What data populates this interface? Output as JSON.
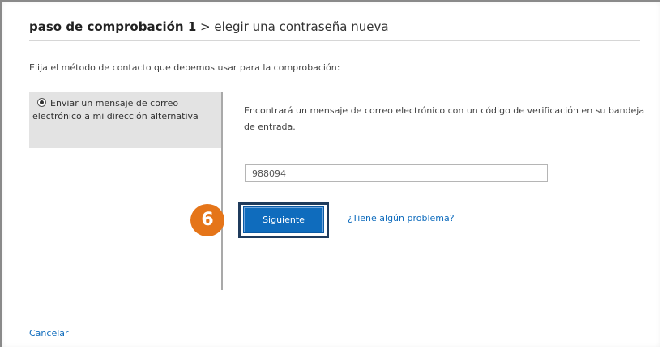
{
  "header": {
    "step_label": "paso de comprobación 1",
    "separator": " > ",
    "subtitle": "elegir una contraseña nueva"
  },
  "instruction": "Elija el método de contacto que debemos usar para la comprobación:",
  "contact_option": {
    "label": "Enviar un mensaje de correo electrónico a mi dirección alternativa",
    "selected": true
  },
  "info_text": "Encontrará un mensaje de correo electrónico con un código de verificación en su bandeja de entrada.",
  "code_input": {
    "value": "988094"
  },
  "next_button": {
    "label": "Siguiente"
  },
  "help_link": "¿Tiene algún problema?",
  "step_badge": "6",
  "cancel_link": "Cancelar",
  "colors": {
    "accent": "#0f6cbd",
    "badge": "#e57519",
    "option_panel": "#e3e3e3"
  }
}
